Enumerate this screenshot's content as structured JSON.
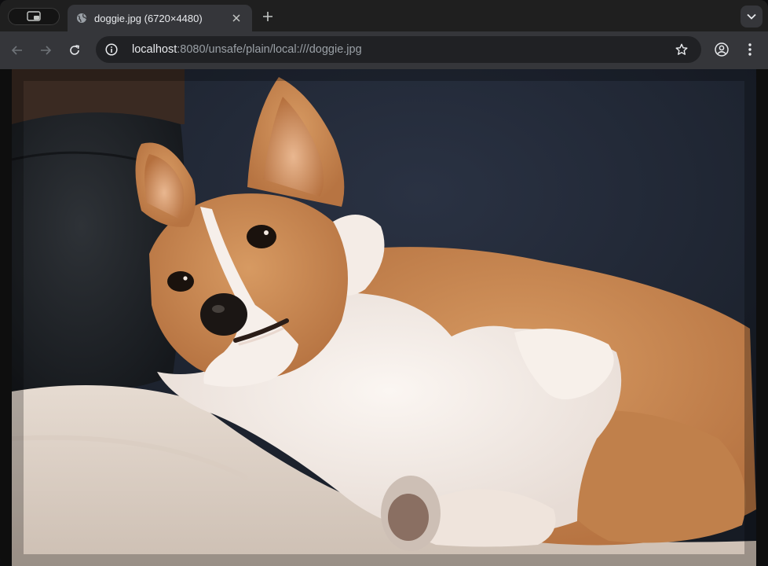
{
  "browser": {
    "tab": {
      "title": "doggie.jpg (6720×4480)",
      "favicon": "globe-icon",
      "close_icon": "close-icon"
    },
    "new_tab_icon": "plus-icon",
    "tab_search_icon": "tab-search-icon",
    "tab_menu_icon": "chevron-down-icon",
    "toolbar": {
      "back_icon": "arrow-left-icon",
      "forward_icon": "arrow-right-icon",
      "reload_icon": "reload-icon",
      "site_info_icon": "info-icon",
      "url_host": "localhost",
      "url_rest": ":8080/unsafe/plain/local:///doggie.jpg",
      "bookmark_icon": "star-icon",
      "profile_icon": "profile-icon",
      "menu_icon": "kebab-menu-icon"
    }
  },
  "content": {
    "image_subject": "corgi-photo",
    "colors": {
      "couch": "#232a38",
      "fur_orange": "#c88a54",
      "fur_white": "#f5ece6",
      "blanket": "#e9ddd2"
    }
  }
}
